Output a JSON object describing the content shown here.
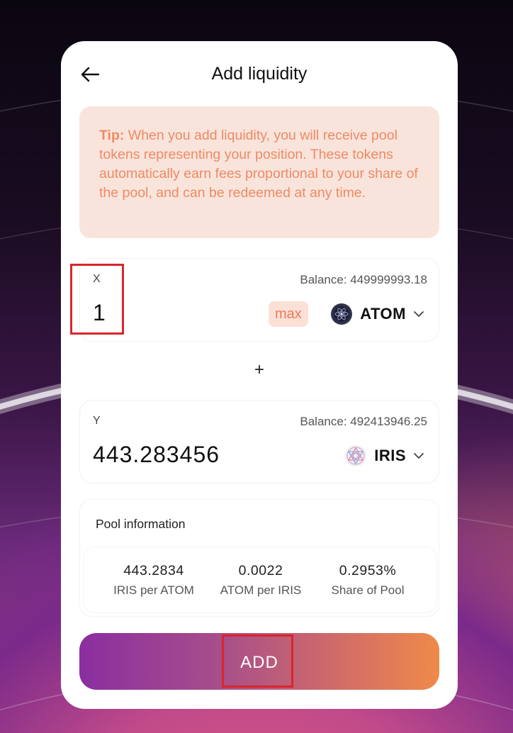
{
  "header": {
    "title": "Add liquidity"
  },
  "tip": {
    "label": "Tip:",
    "text": " When you add liquidity, you will receive pool tokens representing your position. These tokens automatically earn fees proportional to your share of the pool, and can be redeemed at any time."
  },
  "token_x": {
    "label": "X",
    "balance": "Balance: 449999993.18",
    "amount": "1",
    "max_label": "max",
    "symbol": "ATOM"
  },
  "plus_sign": "+",
  "token_y": {
    "label": "Y",
    "balance": "Balance: 492413946.25",
    "amount": "443.283456",
    "symbol": "IRIS"
  },
  "pool_info": {
    "title": "Pool information",
    "stats": [
      {
        "value": "443.2834",
        "label": "IRIS per ATOM"
      },
      {
        "value": "0.0022",
        "label": "ATOM per IRIS"
      },
      {
        "value": "0.2953%",
        "label": "Share of Pool"
      }
    ]
  },
  "add_button": {
    "label": "ADD"
  },
  "icons": {
    "back": "arrow-left-icon",
    "atom": "atom-token-icon",
    "iris": "iris-token-icon",
    "chevron": "chevron-down-icon"
  },
  "colors": {
    "accent": "#ef8a63",
    "tip_bg": "#f9e4dc",
    "button_start": "#8a2ea0",
    "button_end": "#ef8a4a",
    "highlight": "#d9262c"
  }
}
